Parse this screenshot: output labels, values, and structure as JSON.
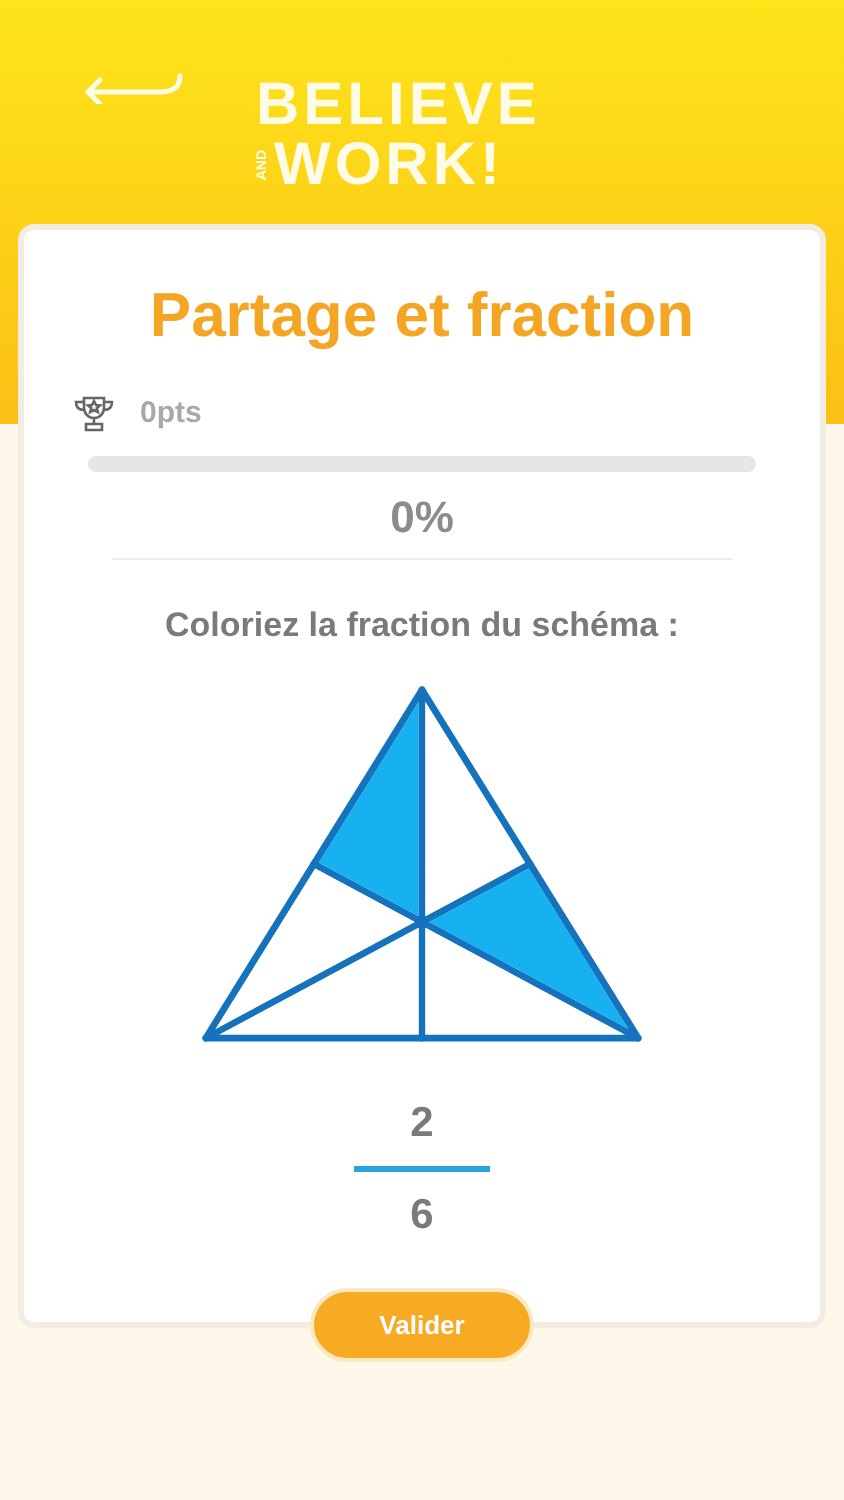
{
  "header": {
    "logo_top": "BELIEVE",
    "logo_small": "AND",
    "logo_bottom": "WORK!"
  },
  "card": {
    "title": "Partage et fraction",
    "points": "0pts",
    "progress": {
      "level": 0,
      "reading": "0%"
    },
    "instruction": "Coloriez la fraction du schéma :",
    "regions": [
      {
        "shaded": true
      },
      {
        "shaded": false
      },
      {
        "shaded": true
      },
      {
        "shaded": false
      },
      {
        "shaded": false
      },
      {
        "shaded": false
      }
    ],
    "fraction": {
      "numerator": "2",
      "denominator": "6"
    }
  },
  "button": "Valider"
}
